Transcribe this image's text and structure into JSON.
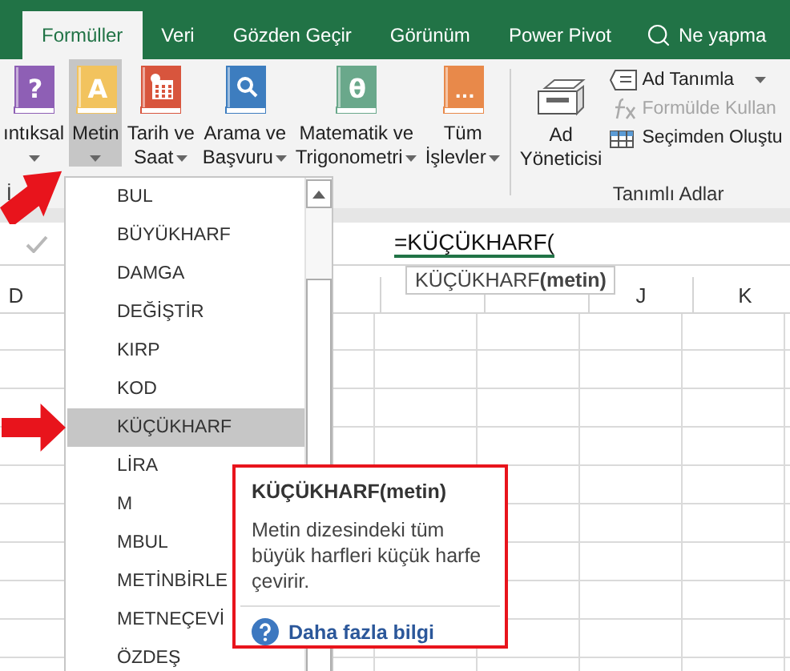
{
  "tabs": [
    {
      "label": "Formüller",
      "selected": true
    },
    {
      "label": "Veri",
      "selected": false
    },
    {
      "label": "Gözden Geçir",
      "selected": false
    },
    {
      "label": "Görünüm",
      "selected": false
    },
    {
      "label": "Power Pivot",
      "selected": false
    }
  ],
  "search": {
    "placeholder": "Ne yapma"
  },
  "ribbon": {
    "function_buttons": [
      {
        "lines": [
          "ıntıksal"
        ],
        "kind": "glyph",
        "glyph": "?",
        "color": "#8e5fb5",
        "selected": false
      },
      {
        "lines": [
          "Metin"
        ],
        "kind": "glyph",
        "glyph": "A",
        "color": "#f2c35e",
        "selected": true
      },
      {
        "lines": [
          "Tarih ve",
          "Saat"
        ],
        "kind": "calendar",
        "color": "#d8553d",
        "selected": false
      },
      {
        "lines": [
          "Arama ve",
          "Başvuru"
        ],
        "kind": "search",
        "color": "#3d7dbf",
        "selected": false
      },
      {
        "lines": [
          "Matematik ve",
          "Trigonometri"
        ],
        "kind": "glyph",
        "glyph": "θ",
        "color": "#6aa88b",
        "selected": false
      },
      {
        "lines": [
          "Tüm",
          "İşlevler"
        ],
        "kind": "glyph",
        "glyph": "...",
        "color": "#e8894a",
        "selected": false
      }
    ],
    "left_group_label": "İ",
    "name_manager": {
      "lines": [
        "Ad",
        "Yöneticisi"
      ]
    },
    "name_items": [
      {
        "label": "Ad Tanımla",
        "kind": "tag",
        "disabled": false
      },
      {
        "label": "Formülde Kullan",
        "kind": "fx",
        "disabled": true
      },
      {
        "label": "Seçimden Oluştu",
        "kind": "table",
        "disabled": false
      }
    ],
    "group_label": "Tanımlı Adlar"
  },
  "formula_bar": {
    "value": "=KÜÇÜKHARF(",
    "hint_name": "KÜÇÜKHARF",
    "hint_argument": "(metin)"
  },
  "column_headers": [
    "D",
    "J",
    "K"
  ],
  "function_menu": {
    "items": [
      {
        "label": "BUL",
        "selected": false
      },
      {
        "label": "BÜYÜKHARF",
        "selected": false
      },
      {
        "label": "DAMGA",
        "selected": false
      },
      {
        "label": "DEĞİŞTİR",
        "selected": false
      },
      {
        "label": "KIRP",
        "selected": false
      },
      {
        "label": "KOD",
        "selected": false
      },
      {
        "label": "KÜÇÜKHARF",
        "selected": true
      },
      {
        "label": "LİRA",
        "selected": false
      },
      {
        "label": "M",
        "selected": false
      },
      {
        "label": "MBUL",
        "selected": false
      },
      {
        "label": "METİNBİRLE",
        "selected": false
      },
      {
        "label": "METNEÇEVİ",
        "selected": false
      },
      {
        "label": "ÖZDEŞ",
        "selected": false
      }
    ]
  },
  "tooltip": {
    "title": "KÜÇÜKHARF(metin)",
    "description": "Metin dizesindeki tüm büyük harfleri küçük harfe çevirir.",
    "link": "Daha fazla bilgi"
  }
}
